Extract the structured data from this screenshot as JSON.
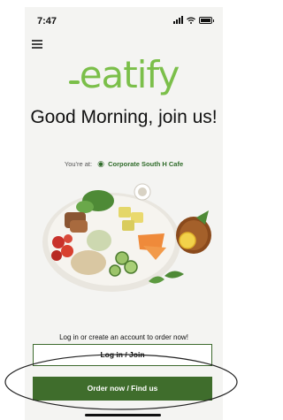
{
  "status_bar": {
    "time": "7:47"
  },
  "app": {
    "logo": "eatify"
  },
  "greeting": "Good Morning, join us!",
  "location": {
    "prefix": "You're at:",
    "name": "Corporate South H Cafe"
  },
  "prompt": "Log in or create an account to order now!",
  "buttons": {
    "login": "Log in / Join",
    "order": "Order now / Find us"
  },
  "colors": {
    "brand_green": "#7bbf4a",
    "button_green": "#3f6d2c"
  },
  "icons": [
    "menu-icon",
    "location-pin-icon",
    "signal-icon",
    "wifi-icon",
    "battery-icon"
  ]
}
